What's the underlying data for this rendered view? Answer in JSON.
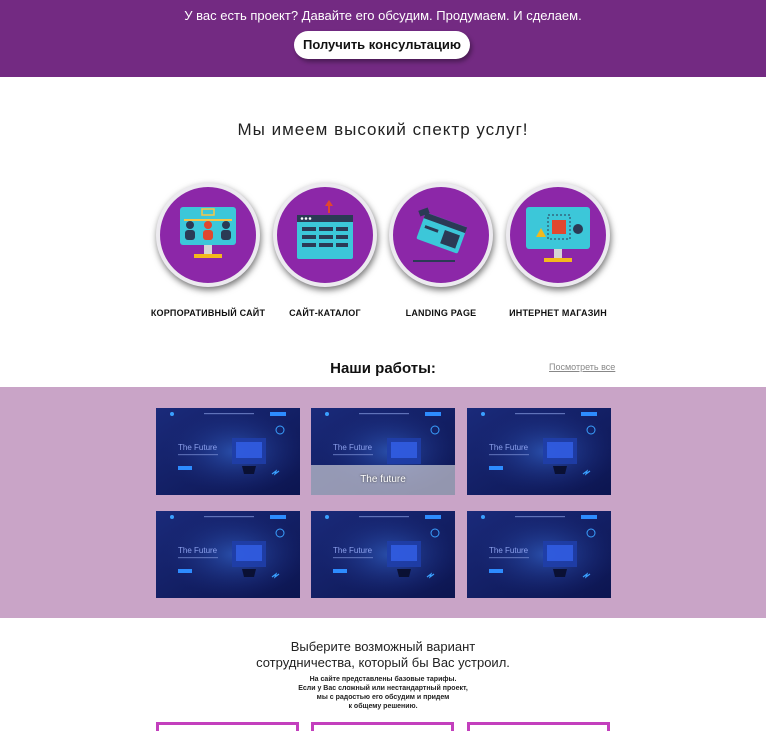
{
  "banner": {
    "message": "У вас есть проект? Давайте его обсудим. Продумаем. И сделаем.",
    "cta_label": "Получить консультацию"
  },
  "services": {
    "title": "Мы имеем высокий спектр услуг!",
    "items": [
      {
        "label": "КОРПОРАТИВНЫЙ САЙТ",
        "icon": "corporate-team-monitor-icon"
      },
      {
        "label": "САЙТ-КАТАЛОГ",
        "icon": "catalog-window-icon"
      },
      {
        "label": "LANDING PAGE",
        "icon": "landing-page-icon"
      },
      {
        "label": "ИНТЕРНЕТ МАГАЗИН",
        "icon": "online-store-monitor-icon"
      }
    ]
  },
  "works": {
    "title": "Наши работы:",
    "view_all": "Посмотреть все",
    "hover_caption": "The future",
    "items": [
      {
        "heading": "The Future"
      },
      {
        "heading": "The Future"
      },
      {
        "heading": "The Future"
      },
      {
        "heading": "The Future"
      },
      {
        "heading": "The Future"
      },
      {
        "heading": "The Future"
      }
    ]
  },
  "cooperation": {
    "title_line1": "Выберите возможный вариант",
    "title_line2": "сотрудничества, который бы Вас устроил.",
    "sub_line1": "На сайте представлены базовые тарифы.",
    "sub_line2": "Если у Вас сложный или нестандартный проект,",
    "sub_line3": "мы с радостью его обсудим и придем",
    "sub_line4": "к общему решению."
  },
  "colors": {
    "banner": "#732a82",
    "circle": "#8c27a8",
    "works_band": "#c9a4c7",
    "plan_border": "#c33fbd"
  }
}
